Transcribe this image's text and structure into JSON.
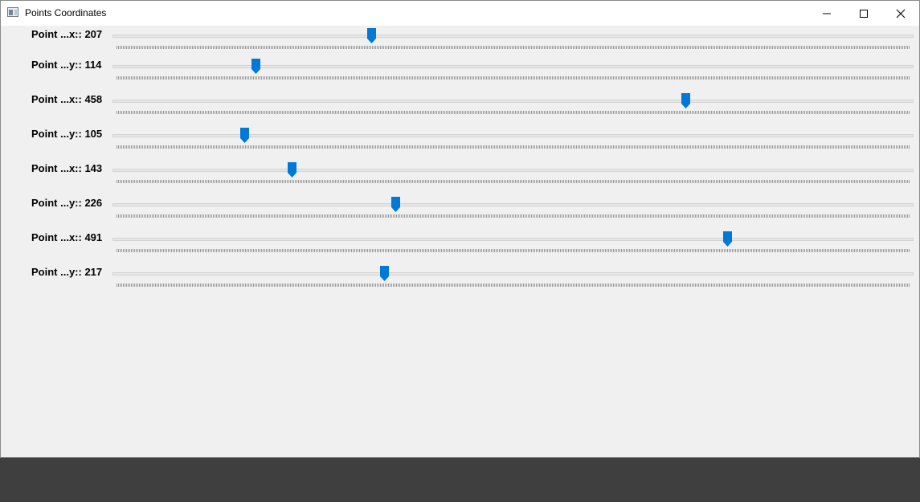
{
  "window": {
    "title": "Points Coordinates",
    "icon": "window-app-icon",
    "controls": [
      "minimize-icon",
      "maximize-icon",
      "close-icon"
    ]
  },
  "slider_range": {
    "min": 0,
    "max": 640
  },
  "sliders": [
    {
      "label": "Point ...x:: 207",
      "value": 207
    },
    {
      "label": "Point ...y:: 114",
      "value": 114
    },
    {
      "label": "Point ...x:: 458",
      "value": 458
    },
    {
      "label": "Point ...y:: 105",
      "value": 105
    },
    {
      "label": "Point ...x:: 143",
      "value": 143
    },
    {
      "label": "Point ...y:: 226",
      "value": 226
    },
    {
      "label": "Point ...x:: 491",
      "value": 491
    },
    {
      "label": "Point ...y:: 217",
      "value": 217
    }
  ],
  "colors": {
    "accent": "#0078d7",
    "window_bg": "#f0f0f0",
    "titlebar_bg": "#ffffff",
    "taskbar_bg": "#3f3f3f"
  }
}
